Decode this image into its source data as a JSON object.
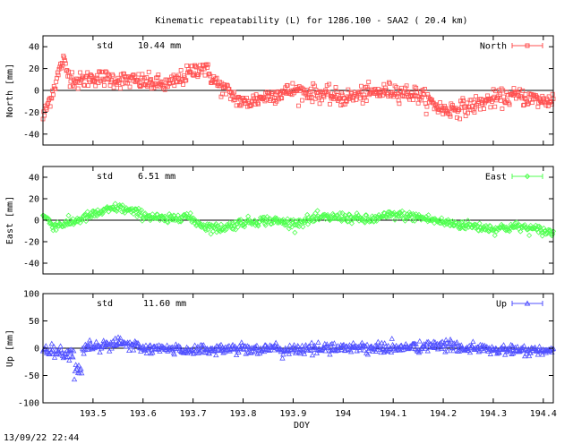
{
  "title": "Kinematic repeatability (L) for 1286.100 - SAA2  ( 20.4 km)",
  "timestamp": "13/09/22 22:44",
  "xlabel": "DOY",
  "chart_data": [
    {
      "type": "scatter",
      "series": [
        {
          "name": "North",
          "color": "#ff5050",
          "marker": "square"
        }
      ],
      "ylabel": "North [mm]",
      "std_label": "std",
      "std_value": "10.44 mm",
      "xlim": [
        193.4,
        194.42
      ],
      "ylim": [
        -50,
        50
      ],
      "yticks": [
        -40,
        -20,
        0,
        20,
        40
      ],
      "trend": {
        "x": [
          193.4,
          193.42,
          193.44,
          193.45,
          193.47,
          193.5,
          193.55,
          193.6,
          193.65,
          193.68,
          193.7,
          193.72,
          193.75,
          193.78,
          193.8,
          193.85,
          193.9,
          193.95,
          194.0,
          194.05,
          194.1,
          194.15,
          194.2,
          194.25,
          194.3,
          194.35,
          194.4,
          194.42
        ],
        "y": [
          -25,
          0,
          28,
          15,
          8,
          12,
          10,
          8,
          5,
          12,
          18,
          22,
          5,
          -5,
          -12,
          -5,
          0,
          -3,
          -7,
          -3,
          0,
          -4,
          -18,
          -15,
          -8,
          -5,
          -10,
          -8
        ]
      },
      "noise": 7,
      "n_points": 700
    },
    {
      "type": "scatter",
      "series": [
        {
          "name": "East",
          "color": "#50ff50",
          "marker": "diamond"
        }
      ],
      "ylabel": "East [mm]",
      "std_label": "std",
      "std_value": "6.51 mm",
      "xlim": [
        193.4,
        194.42
      ],
      "ylim": [
        -50,
        50
      ],
      "yticks": [
        -40,
        -20,
        0,
        20,
        40
      ],
      "trend": {
        "x": [
          193.4,
          193.42,
          193.45,
          193.5,
          193.55,
          193.6,
          193.65,
          193.68,
          193.72,
          193.75,
          193.8,
          193.85,
          193.9,
          193.95,
          194.0,
          194.05,
          194.1,
          194.15,
          194.2,
          194.25,
          194.3,
          194.35,
          194.4,
          194.42
        ],
        "y": [
          5,
          -5,
          -3,
          5,
          12,
          5,
          0,
          5,
          -5,
          -8,
          -2,
          0,
          -3,
          2,
          3,
          0,
          5,
          3,
          -2,
          -5,
          -8,
          -6,
          -10,
          -12
        ]
      },
      "noise": 4,
      "n_points": 700
    },
    {
      "type": "scatter",
      "series": [
        {
          "name": "Up",
          "color": "#5050ff",
          "marker": "triangle"
        }
      ],
      "ylabel": "Up [mm]",
      "std_label": "std",
      "std_value": "11.60 mm",
      "xlim": [
        193.4,
        194.42
      ],
      "ylim": [
        -100,
        100
      ],
      "yticks": [
        -100,
        -50,
        0,
        50,
        100
      ],
      "xticks": [
        193.5,
        193.6,
        193.7,
        193.8,
        193.9,
        194,
        194.1,
        194.2,
        194.3,
        194.4
      ],
      "trend": {
        "x": [
          193.4,
          193.45,
          193.5,
          193.55,
          193.6,
          193.7,
          193.8,
          193.9,
          194.0,
          194.1,
          194.2,
          194.3,
          194.4,
          194.42
        ],
        "y": [
          0,
          -10,
          5,
          10,
          0,
          -3,
          0,
          -3,
          2,
          0,
          5,
          -3,
          -5,
          -8
        ],
        "y_dip_note": ""
      },
      "noise": 9,
      "n_points": 700
    }
  ]
}
